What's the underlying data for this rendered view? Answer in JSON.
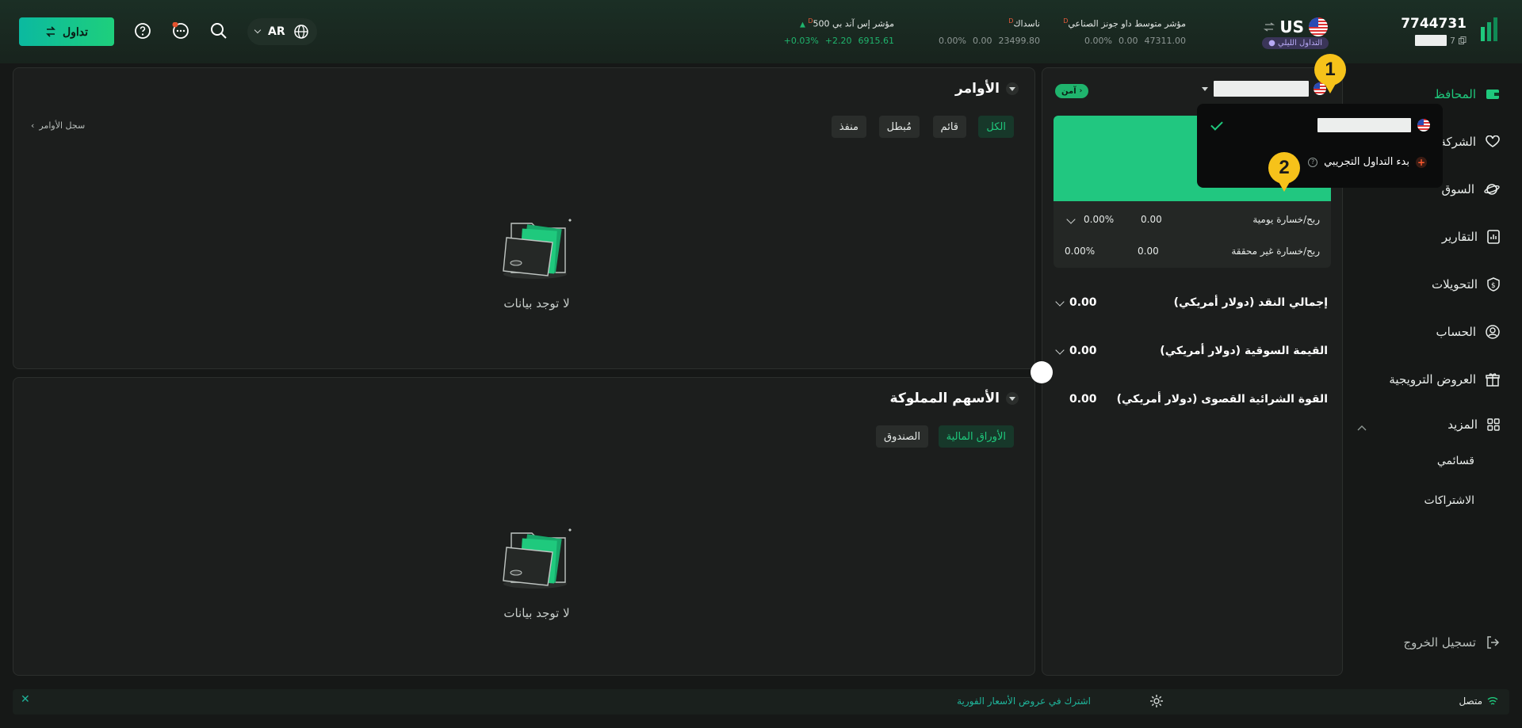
{
  "header": {
    "account_id": "7744731",
    "account_sub_prefix": "7",
    "market": {
      "code": "US",
      "badge": "التداول الليلي"
    },
    "indices": [
      {
        "name": "مؤشر متوسط داو جونز الصناعي",
        "sup": "D",
        "value": "47311.00",
        "change": "0.00",
        "pct": "0.00%"
      },
      {
        "name": "ناسداك",
        "sup": "D",
        "value": "23499.80",
        "change": "0.00",
        "pct": "0.00%"
      },
      {
        "name": "مؤشر إس آند بي 500",
        "sup": "D",
        "value": "6915.61",
        "change": "+2.20",
        "pct": "+0.03%"
      }
    ],
    "lang": "AR",
    "trade_button": "تداول"
  },
  "sidebar": {
    "items": [
      {
        "label": "المحافظ",
        "icon": "wallet-icon"
      },
      {
        "label": "الشركة",
        "icon": "heart-icon"
      },
      {
        "label": "السوق",
        "icon": "planet-icon"
      },
      {
        "label": "التقارير",
        "icon": "report-icon"
      },
      {
        "label": "التحويلات",
        "icon": "transfer-icon"
      },
      {
        "label": "الحساب",
        "icon": "user-icon"
      },
      {
        "label": "العروض الترويجية",
        "icon": "gift-icon"
      },
      {
        "label": "المزيد",
        "icon": "grid-icon"
      }
    ],
    "sub_items": [
      "قسائمي",
      "الاشتراكات"
    ],
    "logout": "تسجيل الخروج"
  },
  "account_panel": {
    "safe_badge": "آمن",
    "pl": [
      {
        "label": "ربح/خسارة يومية",
        "value": "0.00",
        "pct": "0.00%"
      },
      {
        "label": "ربح/خسارة غير محققة",
        "value": "0.00",
        "pct": "0.00%"
      }
    ],
    "summary": [
      {
        "label": "إجمالي النقد (دولار أمريكي)",
        "value": "0.00"
      },
      {
        "label": "القيمة السوقية (دولار أمريكي)",
        "value": "0.00"
      },
      {
        "label": "القوة الشرائية القصوى (دولار أمريكي)",
        "value": "0.00"
      }
    ]
  },
  "dropdown": {
    "start_demo": "بدء التداول التجريبي"
  },
  "markers": [
    "1",
    "2"
  ],
  "orders": {
    "title": "الأوامر",
    "filters": [
      "الكل",
      "قائم",
      "مُبطل",
      "منفذ"
    ],
    "history": "سجل الأوامر",
    "empty": "لا توجد بيانات"
  },
  "holdings": {
    "title": "الأسهم المملوكة",
    "filters": [
      "الأوراق المالية",
      "الصندوق"
    ],
    "empty": "لا توجد بيانات"
  },
  "statusbar": {
    "connected": "متصل",
    "subscribe": "اشترك في عروض الأسعار الفورية"
  },
  "colors": {
    "accent": "#1fc97d",
    "marker": "#f6c21a",
    "bg": "#161817"
  }
}
